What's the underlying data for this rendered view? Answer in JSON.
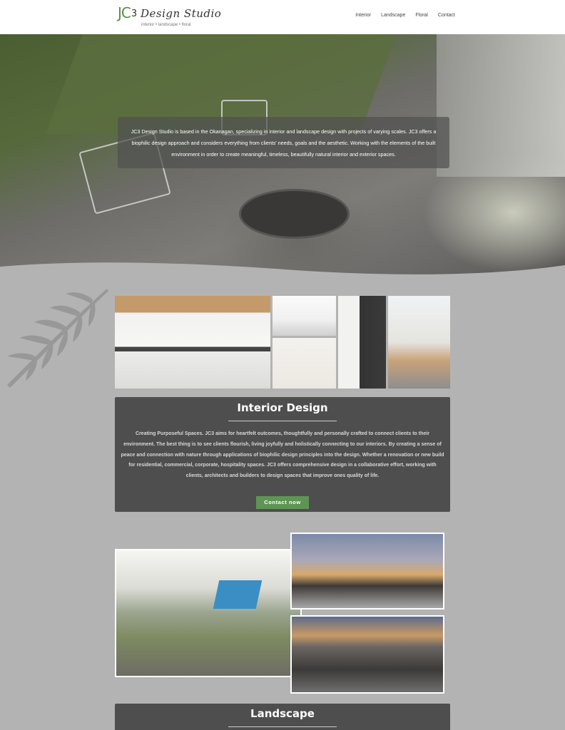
{
  "header": {
    "logo_mark": "JC",
    "logo_mark_three": "3",
    "logo_text": "Design Studio",
    "tagline": "interior • landscape • floral",
    "nav": [
      {
        "label": "Interior"
      },
      {
        "label": "Landscape"
      },
      {
        "label": "Floral"
      },
      {
        "label": "Contact"
      }
    ]
  },
  "hero": {
    "text": "JC3 Design Studio is based in the Okanagan, specializing in interior and landscape design with projects of varying scales. JC3 offers a biophilic design approach and considers everything from clients' needs, goals and the aesthetic. Working with the elements of the built environment in order to create meaningful, timeless, beautifully natural interior and exterior spaces."
  },
  "interior": {
    "title": "Interior Design",
    "body": "Creating Purposeful Spaces. JC3 aims for heartfelt outcomes, thoughtfully and personally crafted to connect clients to their environment. The best thing is to see clients flourish, living joyfully and holistically connecting to our interiors. By creating a sense of peace and connection with nature through applications of biophilic design principles into the design. Whether a renovation or new build for residential, commercial, corporate, hospitality spaces. JC3 offers comprehensive design in a collaborative effort, working with clients, architects and builders to design spaces that improve ones quality of life.",
    "cta": "Contact now"
  },
  "landscape": {
    "title": "Landscape"
  },
  "colors": {
    "accent_green": "#5f9554",
    "page_bg": "#b3b3b3",
    "card_bg": "#4e4e4e"
  }
}
